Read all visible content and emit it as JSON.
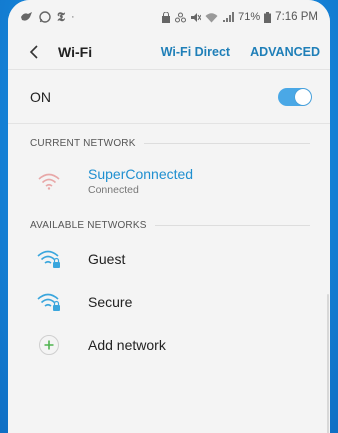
{
  "status_bar": {
    "battery": "71%",
    "time": "7:16 PM"
  },
  "header": {
    "title": "Wi-Fi",
    "wifi_direct": "Wi-Fi Direct",
    "advanced": "ADVANCED"
  },
  "switch": {
    "label": "ON",
    "state": "on"
  },
  "current_network": {
    "section_label": "CURRENT NETWORK",
    "name": "SuperConnected",
    "status": "Connected"
  },
  "available_networks": {
    "section_label": "AVAILABLE NETWORKS",
    "items": [
      {
        "name": "Guest",
        "icon": "wifi-lock-icon"
      },
      {
        "name": "Secure",
        "icon": "wifi-lock-icon"
      }
    ],
    "add_label": "Add network"
  },
  "colors": {
    "accent": "#1f8fd0",
    "toggle": "#4aa8e6",
    "wifi_icon": "#3aa6dd",
    "background": "#1b8fe0"
  }
}
